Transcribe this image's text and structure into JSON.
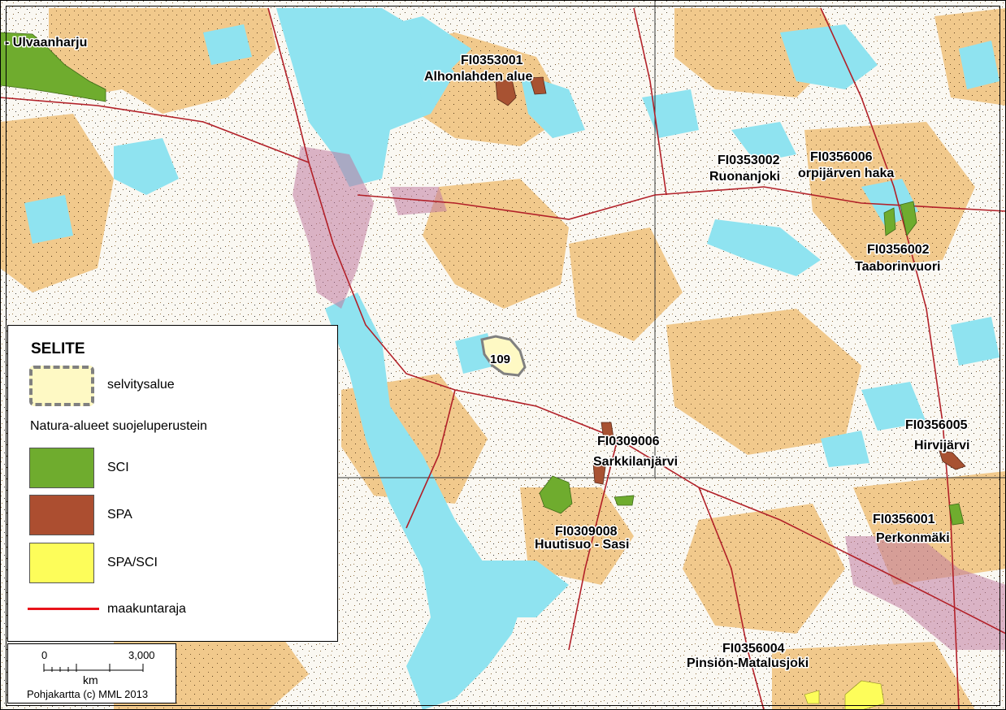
{
  "map": {
    "colors": {
      "water": "#8fe3f0",
      "field": "#f1c98c",
      "forest": "#f8f5ee",
      "road": "#b22028",
      "sci": "#6fac2e",
      "spa": "#a85232"
    },
    "labels": {
      "ulvaanharju": "- Ulvaanharju",
      "fi0353001_code": "FI0353001",
      "fi0353001_name": "Alhonlahden alue",
      "fi0353002_code": "FI0353002",
      "fi0353002_name": "Ruonanjoki",
      "fi0356006_code": "FI0356006",
      "fi0356006_name": "orpijärven haka",
      "fi0356002_code": "FI0356002",
      "fi0356002_name": "Taaborinvuori",
      "site_109": "109",
      "fi0356005_code": "FI0356005",
      "fi0356005_name": "Hirvijärvi",
      "fi0309006_code": "FI0309006",
      "fi0309006_name": "Sarkkilanjärvi",
      "fi0309008_code": "FI0309008",
      "fi0309008_name": "Huutisuo - Sasi",
      "fi0356001_code": "FI0356001",
      "fi0356001_name": "Perkonmäki",
      "fi0356004_code": "FI0356004",
      "fi0356004_name": "Pinsiön-Matalusjoki"
    }
  },
  "legend": {
    "title": "SELITE",
    "study_area": "selvitysalue",
    "natura_heading": "Natura-alueet suojeluperustein",
    "sci": "SCI",
    "spa": "SPA",
    "spa_sci": "SPA/SCI",
    "regional_border": "maakuntaraja",
    "colors": {
      "study": "#fef9c4",
      "sci": "#6fac2e",
      "spa": "#ac4e30",
      "spa_sci": "#fdfd5a",
      "border": "#e8141b"
    }
  },
  "scalebar": {
    "zero": "0",
    "max": "3,000",
    "unit": "km",
    "credit": "Pohjakartta (c) MML 2013"
  }
}
